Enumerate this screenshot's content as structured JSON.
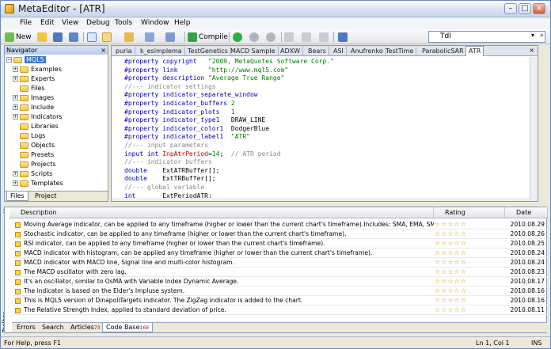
{
  "window": {
    "title": "MetaEditor - [ATR]"
  },
  "menu": [
    {
      "label": "File"
    },
    {
      "label": "Edit"
    },
    {
      "label": "View"
    },
    {
      "label": "Debug"
    },
    {
      "label": "Tools"
    },
    {
      "label": "Window"
    },
    {
      "label": "Help"
    }
  ],
  "toolbar": {
    "new_label": "New",
    "compile_label": "Compile",
    "search_value": "Tdl"
  },
  "navigator": {
    "title": "Navigator",
    "root": "MQL5",
    "items": [
      "Examples",
      "Experts",
      "Files",
      "Images",
      "Include",
      "Indicators",
      "Libraries",
      "Logs",
      "Objects",
      "Presets",
      "Projects",
      "Scripts",
      "Templates"
    ],
    "tabs": [
      "Files",
      "Project"
    ]
  },
  "editor": {
    "tabs": [
      "puria",
      "k_esimplema",
      "TestGenetics",
      "MACD Sample",
      "ADXW",
      "Bears",
      "ASI",
      "Anufrenko",
      "TestTime",
      "ParabolicSAR",
      "ATR"
    ],
    "active_tab": "ATR"
  },
  "codebase": {
    "columns": {
      "description": "Description",
      "rating": "Rating",
      "date": "Date"
    },
    "rows": [
      {
        "description": "Moving Average indicator, can be applied to any timeframe (higher or lower than the current chart's timeframe).Includes: SMA, EMA, SMMA, LWMA....",
        "date": "2010.08.29"
      },
      {
        "description": "Stochastic indicator, can be applied to any timeframe (higher or lower than the current chart's timeframe).",
        "date": "2010.08.26"
      },
      {
        "description": "RSI indicator, can be applied to any timeframe (higher or lower than the current chart's timeframe).",
        "date": "2010.08.25"
      },
      {
        "description": "MACD indicator with histogram, can be applied any timeframe (higher or lower than the current chart's timeframe).",
        "date": "2010.08.24"
      },
      {
        "description": "MACD indicator with MACD line, Signal line and multi-color histogram.",
        "date": "2010.08.24"
      },
      {
        "description": "The MACD oscillator with zero lag.",
        "date": "2010.08.23"
      },
      {
        "description": "It's an oscillator, similar to OsMA with Variable Index Dynamic Average.",
        "date": "2010.08.17"
      },
      {
        "description": "The indicator is based on the Elder's Impluse system.",
        "date": "2010.08.16"
      },
      {
        "description": "This is MQL5 version of DinapoliTargets indicator. The ZigZag indicator is added to the chart.",
        "date": "2010.08.16"
      },
      {
        "description": "The Relative Strength Index, applied to standard deviation of price.",
        "date": "2010.08.11"
      }
    ]
  },
  "toolbox": {
    "label": "Toolbox",
    "tabs": [
      {
        "label": "Errors",
        "badge": ""
      },
      {
        "label": "Search",
        "badge": ""
      },
      {
        "label": "Articles",
        "badge": "73"
      },
      {
        "label": "Code Base",
        "badge": "169"
      }
    ]
  },
  "status": {
    "help": "For Help, press F1",
    "position": "Ln 1, Col 1",
    "mode": "INS"
  }
}
